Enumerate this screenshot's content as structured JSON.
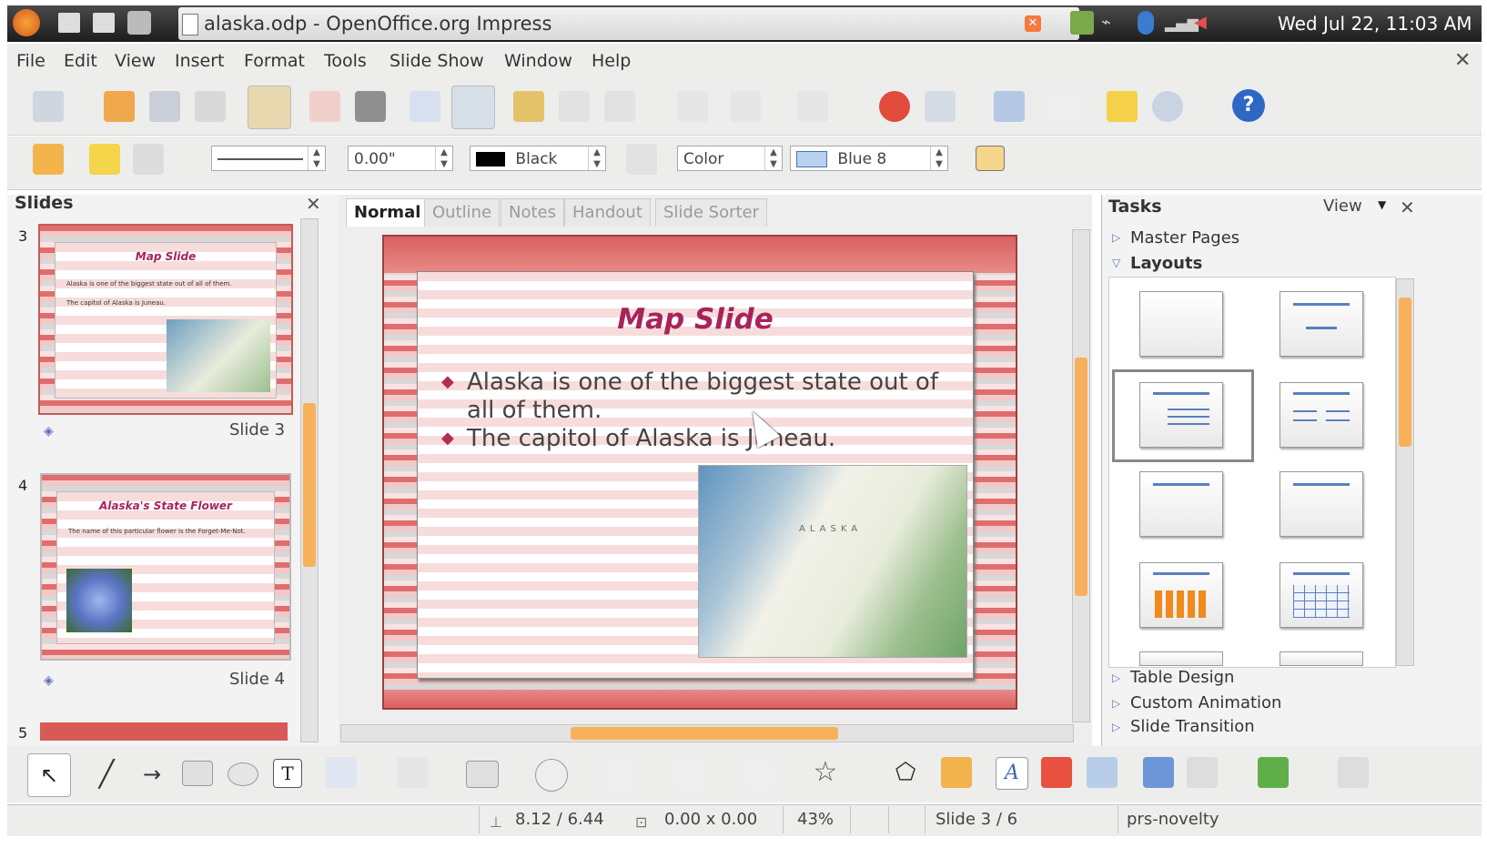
{
  "window": {
    "title": "alaska.odp - OpenOffice.org Impress"
  },
  "system": {
    "clock": "Wed Jul 22, 11:03 AM"
  },
  "menu": [
    "File",
    "Edit",
    "View",
    "Insert",
    "Format",
    "Tools",
    "Slide Show",
    "Window",
    "Help"
  ],
  "line_toolbar": {
    "line_width": "0.00\"",
    "line_color": "Black",
    "area_style": "Color",
    "area_color": "Blue 8"
  },
  "slides_pane": {
    "title": "Slides",
    "thumbs": [
      {
        "number": "3",
        "label": "Slide 3",
        "title": "Map Slide",
        "bullets": [
          "Alaska is one of the biggest state out of all of them.",
          "The capitol of Alaska is Juneau."
        ]
      },
      {
        "number": "4",
        "label": "Slide 4",
        "title": "Alaska's State Flower",
        "bullets": [
          "The name of this particular flower is the Forget-Me-Not."
        ]
      },
      {
        "number": "5"
      }
    ]
  },
  "view_tabs": [
    "Normal",
    "Outline",
    "Notes",
    "Handout",
    "Slide Sorter"
  ],
  "slide": {
    "title": "Map Slide",
    "bullets": [
      "Alaska is one of the biggest state out of all of them.",
      "The capitol of Alaska is Juneau."
    ],
    "map_label": "ALASKA"
  },
  "tasks_pane": {
    "title": "Tasks",
    "view_label": "View",
    "sections": {
      "master_pages": "Master Pages",
      "layouts": "Layouts",
      "table_design": "Table Design",
      "custom_animation": "Custom Animation",
      "slide_transition": "Slide Transition"
    }
  },
  "status": {
    "position": "8.12 / 6.44",
    "size": "0.00 x 0.00",
    "zoom": "43%",
    "slide": "Slide 3 / 6",
    "master": "prs-novelty"
  },
  "colors": {
    "accent": "#f7b15a",
    "slide_title": "#a8235a",
    "bullet": "#b03050",
    "stripe_red": "#e06d6d"
  }
}
